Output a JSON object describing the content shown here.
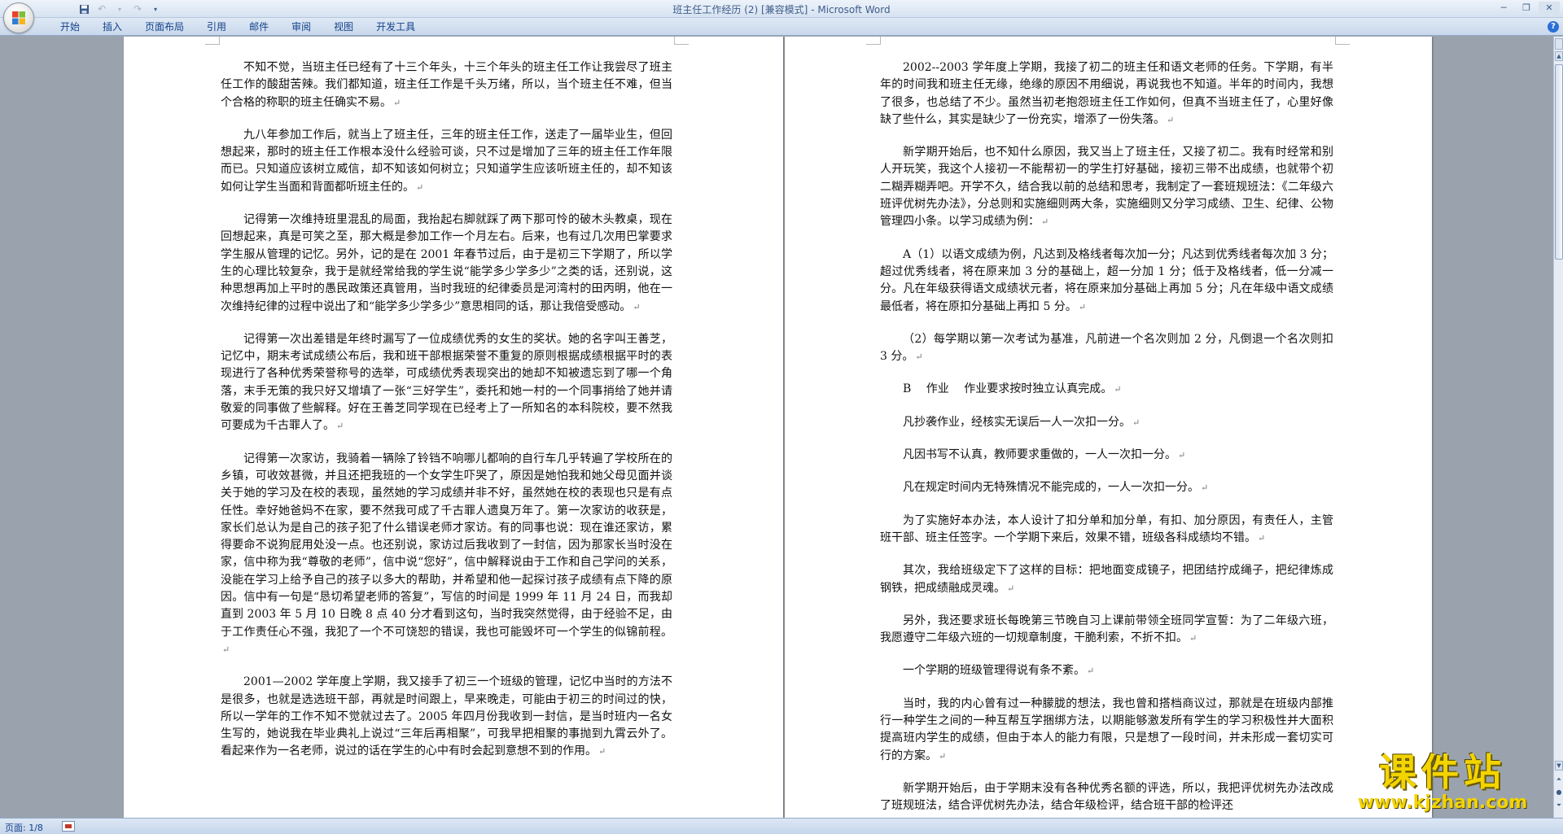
{
  "window": {
    "title": "班主任工作经历 (2) [兼容模式]",
    "app_name": "Microsoft Word",
    "separator": " - "
  },
  "quick_access": {
    "save_icon": "save-icon",
    "undo_icon": "undo-icon",
    "redo_icon": "redo-icon",
    "customize_icon": "customize-icon"
  },
  "ribbon": {
    "tabs": [
      "开始",
      "插入",
      "页面布局",
      "引用",
      "邮件",
      "审阅",
      "视图",
      "开发工具"
    ],
    "help": "?"
  },
  "page_left": {
    "paragraphs": [
      "不知不觉，当班主任已经有了十三个年头，十三个年头的班主任工作让我尝尽了班主任工作的酸甜苦辣。我们都知道，班主任工作是千头万绪，所以，当个班主任不难，但当个合格的称职的班主任确实不易。",
      "九八年参加工作后，就当上了班主任，三年的班主任工作，送走了一届毕业生，但回想起来，那时的班主任工作根本没什么经验可谈，只不过是增加了三年的班主任工作年限而已。只知道应该树立威信，却不知该如何树立；只知道学生应该听班主任的，却不知该如何让学生当面和背面都听班主任的。",
      "记得第一次维持班里混乱的局面，我抬起右脚就踩了两下那可怜的破木头教桌，现在回想起来，真是可笑之至，那大概是参加工作一个月左右。后来，也有过几次用巴掌要求学生服从管理的记忆。另外，记的是在 2001 年春节过后，由于是初三下学期了，所以学生的心理比较复杂，我于是就经常给我的学生说“能学多少学多少”之类的话，还别说，这种思想再加上平时的愚民政策还真管用，当时我班的纪律委员是河湾村的田丙明，他在一次维持纪律的过程中说出了和“能学多少学多少”意思相同的话，那让我倍受感动。",
      "记得第一次出差错是年终时漏写了一位成绩优秀的女生的奖状。她的名字叫王善芝，记忆中，期末考试成绩公布后，我和班干部根据荣誉不重复的原则根据成绩根据平时的表现进行了各种优秀荣誉称号的选举，可成绩优秀表现突出的她却不知被遗忘到了哪一个角落，末手无策的我只好又增填了一张“三好学生”，委托和她一村的一个同事捎给了她并请敬爱的同事做了些解释。好在王善芝同学现在已经考上了一所知名的本科院校，要不然我可要成为千古罪人了。",
      "记得第一次家访，我骑着一辆除了铃铛不响哪儿都响的自行车几乎转遍了学校所在的乡镇，可收效甚微，并且还把我班的一个女学生吓哭了，原因是她怕我和她父母见面并谈关于她的学习及在校的表现，虽然她的学习成绩并非不好，虽然她在校的表现也只是有点任性。幸好她爸妈不在家，要不然我可成了千古罪人遗臭万年了。第一次家访的收获是，家长们总认为是自己的孩子犯了什么错误老师才家访。有的同事也说：现在谁还家访，累得要命不说狗屁用处没一点。也还别说，家访过后我收到了一封信，因为那家长当时没在家，信中称为我“尊敬的老师”，信中说“您好”，信中解释说由于工作和自己学问的关系，没能在学习上给予自己的孩子以多大的帮助，并希望和他一起探讨孩子成绩有点下降的原因。信中有一句是“恳切希望老师的答复”，写信的时间是 1999 年 11 月 24 日，而我却直到 2003 年 5 月 10 日晚 8 点 40 分才看到这句，当时我突然觉得，由于经验不足，由于工作责任心不强，我犯了一个不可饶恕的错误，我也可能毁坏可一个学生的似锦前程。",
      "2001—2002 学年度上学期，我又接手了初三一个班级的管理，记忆中当时的方法不是很多，也就是选选班干部，再就是时间跟上，早来晚走，可能由于初三的时间过的快，所以一学年的工作不知不觉就过去了。2005 年四月份我收到一封信，是当时班内一名女生写的，她说我在毕业典礼上说过“三年后再相聚”，可我早把相聚的事抛到九霄云外了。看起来作为一名老师，说过的话在学生的心中有时会起到意想不到的作用。"
    ]
  },
  "page_right": {
    "paragraphs": [
      "2002--2003 学年度上学期，我接了初二的班主任和语文老师的任务。下学期，有半年的时间我和班主任无缘，绝缘的原因不用细说，再说我也不知道。半年的时间内，我想了很多，也总结了不少。虽然当初老抱怨班主任工作如何，但真不当班主任了，心里好像缺了些什么，其实是缺少了一份充实，增添了一份失落。",
      "新学期开始后，也不知什么原因，我又当上了班主任，又接了初二。我有时经常和别人开玩笑，我这个人接初一不能帮初一的学生打好基础，接初三带不出成绩，也就带个初二糊弄糊弄吧。开学不久，结合我以前的总结和思考，我制定了一套班规班法：《二年级六班评优树先办法》，分总则和实施细则两大条，实施细则又分学习成绩、卫生、纪律、公物管理四小条。以学习成绩为例：",
      "A（1）以语文成绩为例，凡达到及格线者每次加一分；凡达到优秀线者每次加 3 分；超过优秀线者，将在原来加 3 分的基础上，超一分加 1 分；低于及格线者，低一分减一分。凡在年级获得语文成绩状元者，将在原来加分基础上再加 5 分；凡在年级中语文成绩最低者，将在原扣分基础上再扣 5 分。",
      "（2）每学期以第一次考试为基准，凡前进一个名次则加 2 分，凡倒退一个名次则扣 3 分。",
      "B　 作业　 作业要求按时独立认真完成。",
      "凡抄袭作业，经核实无误后一人一次扣一分。",
      "凡因书写不认真，教师要求重做的，一人一次扣一分。",
      "凡在规定时间内无特殊情况不能完成的，一人一次扣一分。",
      "为了实施好本办法，本人设计了扣分单和加分单，有扣、加分原因，有责任人，主管班干部、班主任签字。一个学期下来后，效果不错，班级各科成绩均不错。",
      "其次，我给班级定下了这样的目标：把地面变成镜子，把团结拧成绳子，把纪律炼成钢铁，把成绩融成灵魂。",
      "另外，我还要求班长每晚第三节晚自习上课前带领全班同学宣誓：为了二年级六班，我愿遵守二年级六班的一切规章制度，干脆利索，不折不扣。",
      "一个学期的班级管理得说有条不紊。",
      "当时，我的内心曾有过一种朦胧的想法，我也曾和搭档商议过，那就是在班级内部推行一种学生之间的一种互帮互学捆绑方法，以期能够激发所有学生的学习积极性并大面积提高班内学生的成绩，但由于本人的能力有限，只是想了一段时间，并未形成一套切实可行的方案。",
      "新学期开始后，由于学期末没有各种优秀名额的评选，所以，我把评优树先办法改成了班规班法，结合评优树先办法，结合年级检评，结合班干部的检评还"
    ]
  },
  "status": {
    "page_indicator": "页面: 1/8"
  },
  "watermark": {
    "title": "课件站",
    "url": "www.kjzhan.com"
  },
  "colors": {
    "ribbon_text": "#15428b",
    "watermark": "#f3d400",
    "background": "#9aa3ad"
  }
}
